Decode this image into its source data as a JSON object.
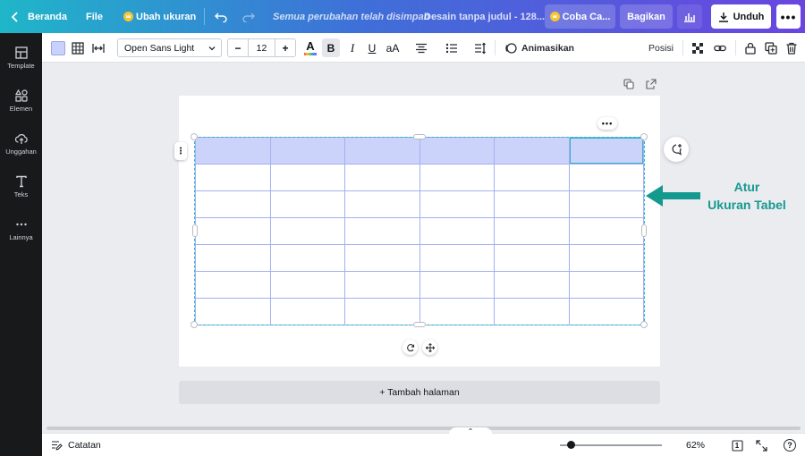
{
  "topbar": {
    "home_label": "Beranda",
    "file_label": "File",
    "resize_label": "Ubah ukuran",
    "save_status": "Semua perubahan telah disimpan",
    "doc_name": "Desain tanpa judul - 128...",
    "trial_label": "Coba Ca...",
    "share_label": "Bagikan",
    "download_label": "Unduh",
    "more_label": "•••",
    "colors": {
      "gradient_start": "#1fb6c9",
      "gradient_end": "#6a45e0"
    }
  },
  "sidebar": {
    "items": [
      {
        "label": "Template",
        "icon": "template-icon"
      },
      {
        "label": "Elemen",
        "icon": "elements-icon"
      },
      {
        "label": "Unggahan",
        "icon": "upload-icon"
      },
      {
        "label": "Teks",
        "icon": "text-icon"
      },
      {
        "label": "Lainnya",
        "icon": "more-icon"
      }
    ]
  },
  "toolbar": {
    "font_name": "Open Sans Light",
    "font_size": "12",
    "minus_label": "−",
    "plus_label": "+",
    "text_color_glyph": "A",
    "bold_glyph": "B",
    "italic_glyph": "I",
    "underline_glyph": "U",
    "case_glyph": "aA",
    "animate_label": "Animasikan",
    "position_label": "Posisi",
    "cell_color": "#c9d2fc"
  },
  "canvas": {
    "more_pill": "•••",
    "side_handle": "⋮",
    "table": {
      "rows": 7,
      "cols": 6,
      "header_color": "#cbd3fb",
      "border_color": "#a5b0f0"
    },
    "annotation": {
      "line1": "Atur",
      "line2": "Ukuran Tabel",
      "color": "#14998f"
    },
    "add_page_label": "+ Tambah halaman"
  },
  "footer": {
    "notes_label": "Catatan",
    "zoom": "62%",
    "page_count": "1",
    "help_glyph": "?",
    "collapse_glyph": "⌃"
  }
}
